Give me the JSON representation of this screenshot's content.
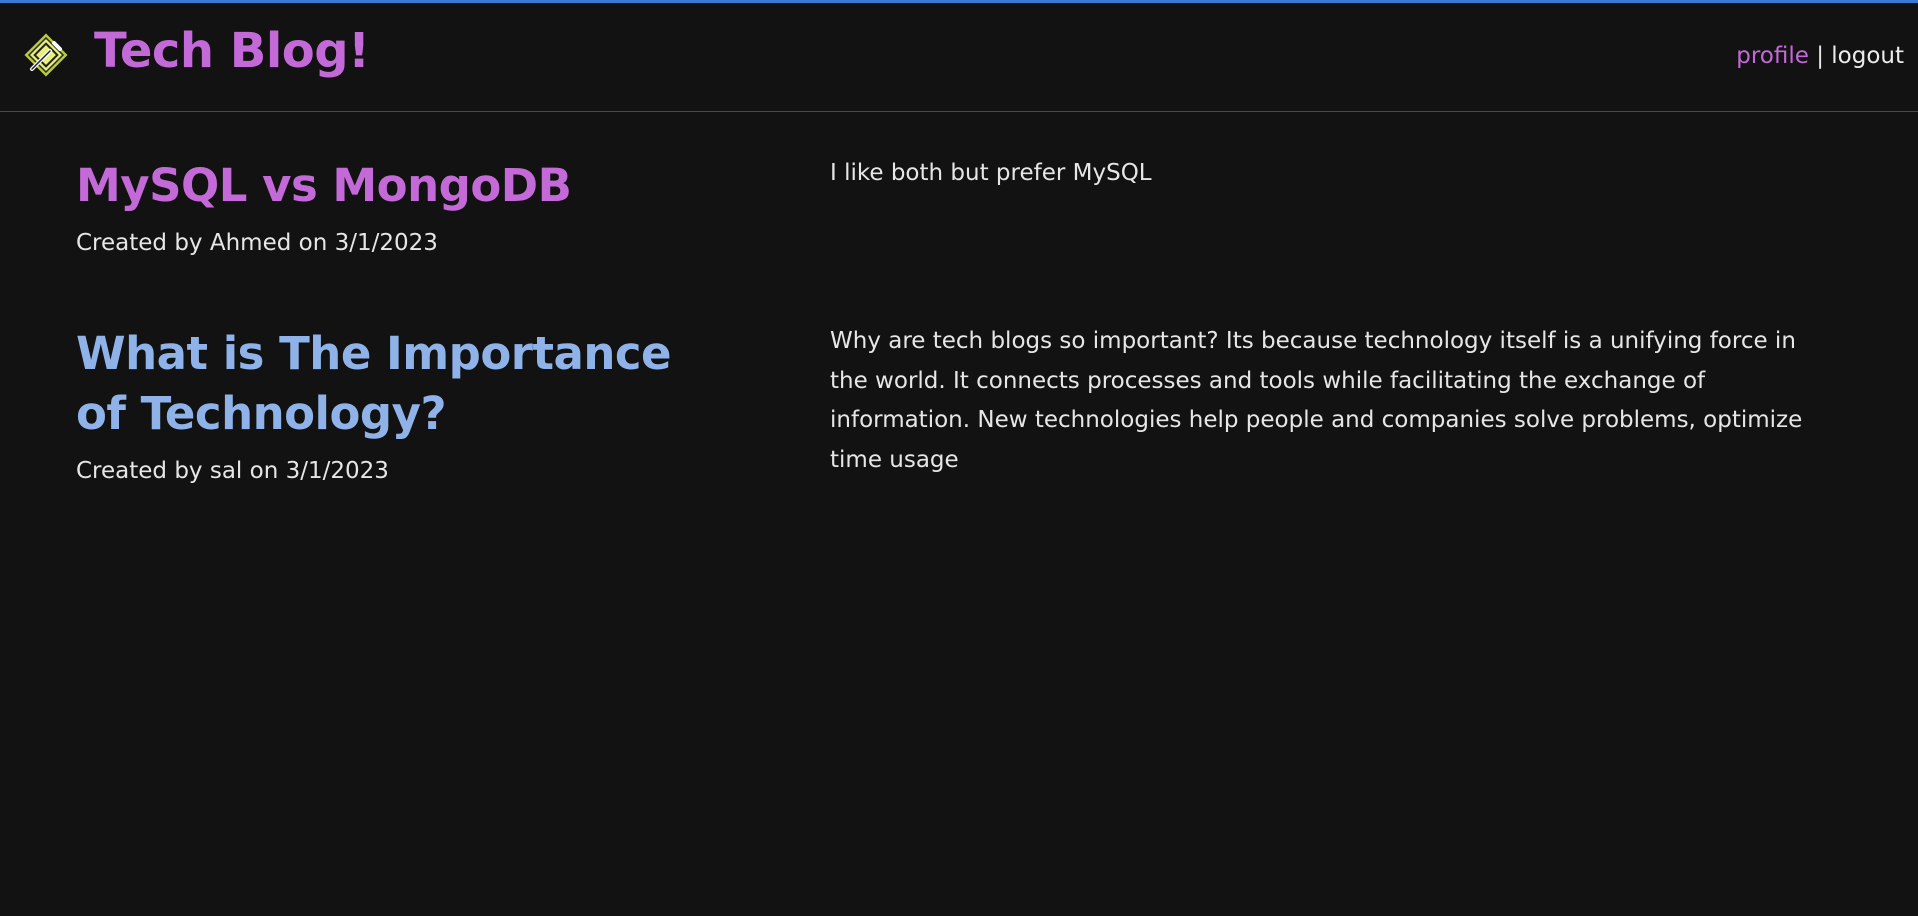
{
  "header": {
    "site_title": "Tech Blog!",
    "logo_icon": "badge-logo-icon",
    "nav": {
      "profile_label": "profile",
      "separator": "|",
      "logout_label": "logout"
    }
  },
  "posts": [
    {
      "title": "MySQL vs MongoDB",
      "meta": "Created by Ahmed on 3/1/2023",
      "body": "I like both but prefer MySQL",
      "title_color": "#c46ad8"
    },
    {
      "title": "What is The Importance of Technology?",
      "meta": "Created by sal on 3/1/2023",
      "body": "Why are tech blogs so important? Its because technology itself is a unifying force in the world. It connects processes and tools while facilitating the exchange of information. New technologies help people and companies solve problems, optimize time usage",
      "title_color": "#8fb3e8"
    }
  ],
  "colors": {
    "background": "#121212",
    "accent": "#c46ad8",
    "accent_blue": "#8fb3e8",
    "top_line": "#3a7bd5"
  }
}
